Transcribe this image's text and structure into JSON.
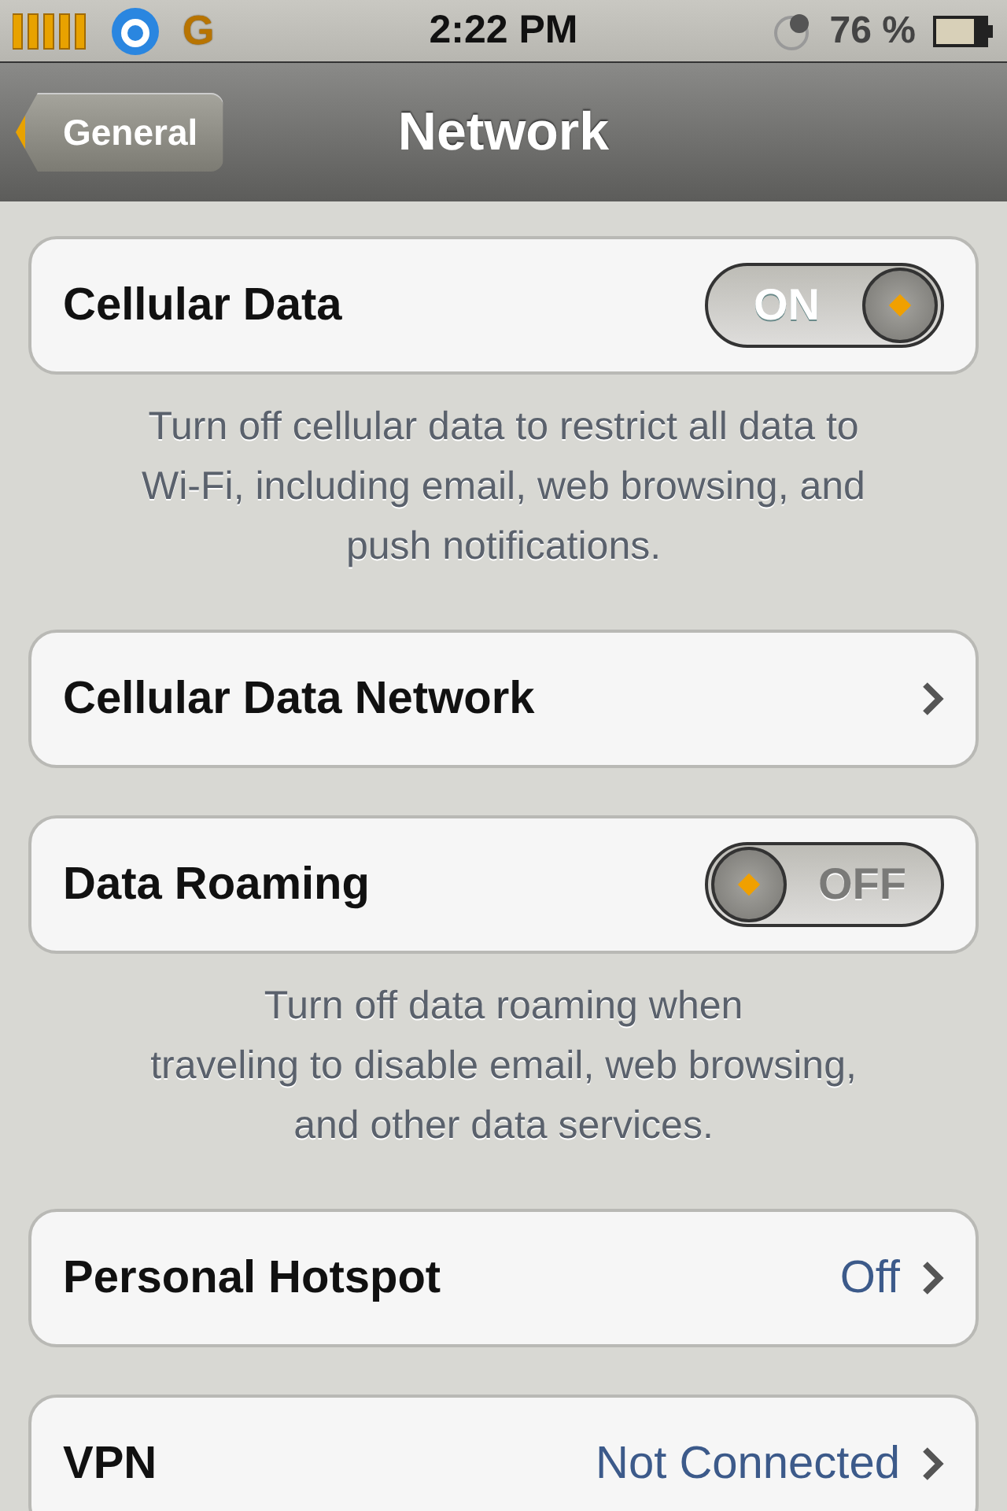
{
  "status_bar": {
    "network": "G",
    "time": "2:22 PM",
    "battery_percent": "76 %"
  },
  "nav_bar": {
    "back_button": "General",
    "title": "Network"
  },
  "sections": [
    {
      "rows": [
        {
          "kind": "toggle",
          "label": "Cellular Data",
          "on": true,
          "text": "ON"
        }
      ],
      "footer": "Turn off cellular data to restrict all data to\nWi-Fi, including email, web browsing, and\npush notifications."
    },
    {
      "rows": [
        {
          "kind": "link",
          "label": "Cellular Data Network"
        }
      ]
    },
    {
      "rows": [
        {
          "kind": "toggle",
          "label": "Data Roaming",
          "on": false,
          "text": "OFF"
        }
      ],
      "footer": "Turn off data roaming when\ntraveling to disable email, web browsing,\nand other data services."
    },
    {
      "rows": [
        {
          "kind": "link",
          "label": "Personal Hotspot",
          "value": "Off"
        }
      ]
    },
    {
      "rows": [
        {
          "kind": "link",
          "label": "VPN",
          "value": "Not Connected"
        }
      ]
    }
  ]
}
